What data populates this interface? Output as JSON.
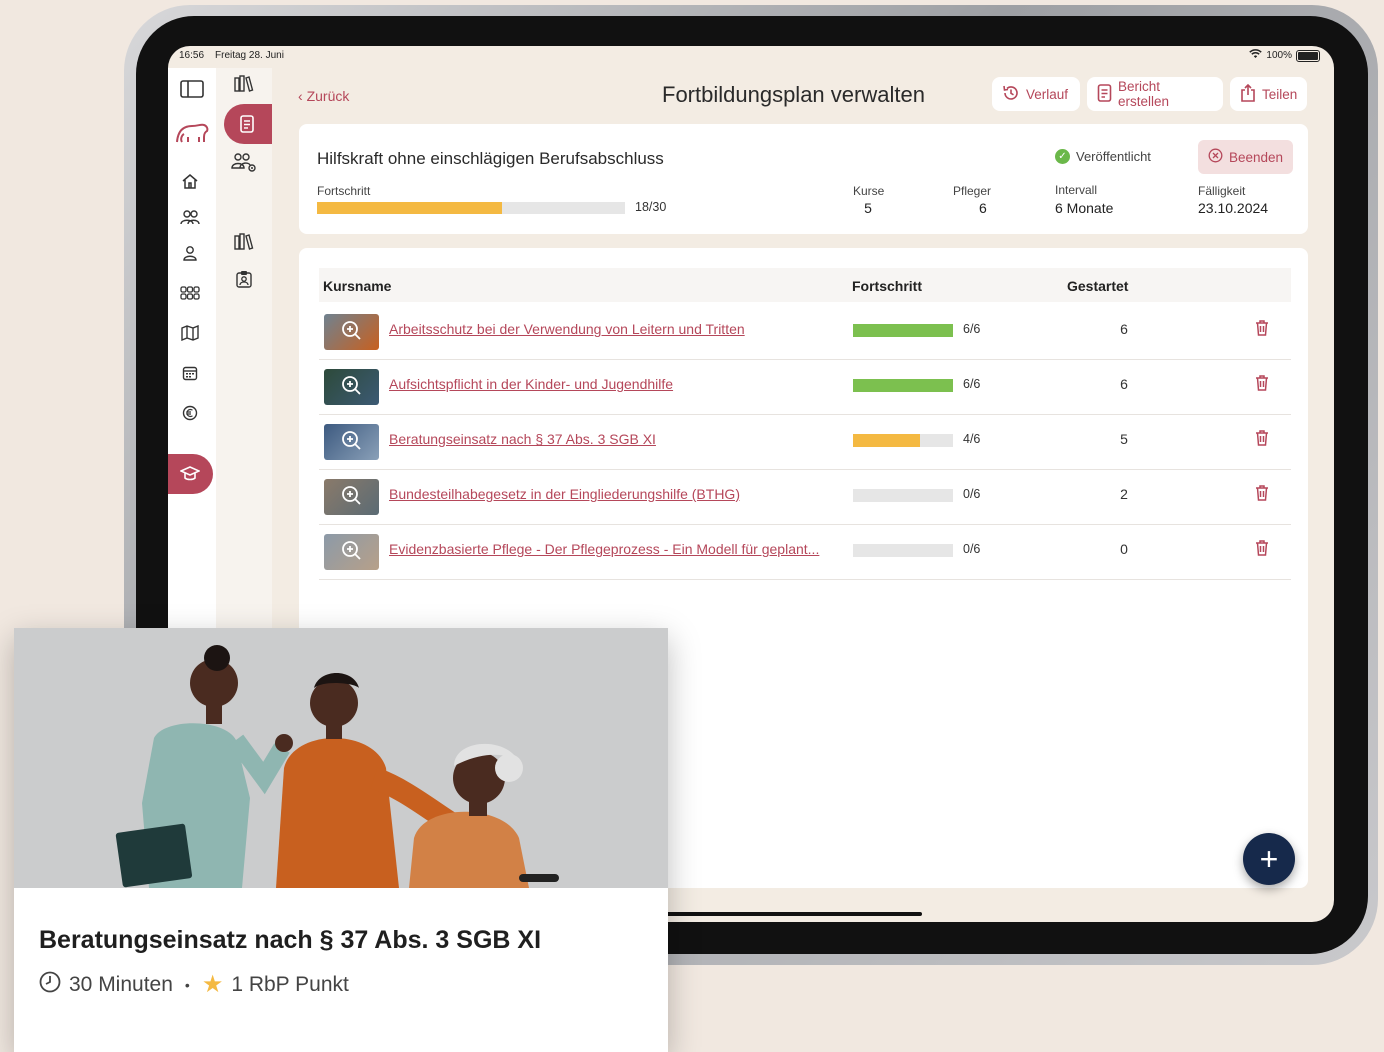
{
  "status_bar": {
    "time": "16:56",
    "date": "Freitag 28. Juni",
    "battery": "100%"
  },
  "header": {
    "back_label": "Zurück",
    "title": "Fortbildungsplan verwalten",
    "buttons": {
      "history": "Verlauf",
      "report": "Bericht erstellen",
      "share": "Teilen"
    }
  },
  "plan": {
    "name": "Hilfskraft ohne einschlägigen Berufsabschluss",
    "status": "Veröffentlicht",
    "end_label": "Beenden",
    "progress_label": "Fortschritt",
    "progress_text": "18/30",
    "progress_fraction": 0.6,
    "stats": {
      "courses_label": "Kurse",
      "courses": "5",
      "carers_label": "Pfleger",
      "carers": "6",
      "interval_label": "Intervall",
      "interval": "6 Monate",
      "due_label": "Fälligkeit",
      "due": "23.10.2024"
    }
  },
  "table": {
    "headers": {
      "name": "Kursname",
      "progress": "Fortschritt",
      "started": "Gestartet"
    },
    "rows": [
      {
        "name": "Arbeitsschutz bei der Verwendung von Leitern und Tritten",
        "progress_text": "6/6",
        "progress_fraction": 1.0,
        "started": "6",
        "color": "#7cc04f"
      },
      {
        "name": "Aufsichtspflicht in der Kinder- und Jugendhilfe",
        "progress_text": "6/6",
        "progress_fraction": 1.0,
        "started": "6",
        "color": "#7cc04f"
      },
      {
        "name": "Beratungseinsatz nach § 37 Abs. 3 SGB XI",
        "progress_text": "4/6",
        "progress_fraction": 0.667,
        "started": "5",
        "color": "#f4b942"
      },
      {
        "name": "Bundesteilhabegesetz in der Eingliederungshilfe (BTHG)",
        "progress_text": "0/6",
        "progress_fraction": 0,
        "started": "2",
        "color": "#f4b942"
      },
      {
        "name": "Evidenzbasierte Pflege - Der Pflegeprozess - Ein Modell für geplant...",
        "progress_text": "0/6",
        "progress_fraction": 0,
        "started": "0",
        "color": "#f4b942"
      }
    ]
  },
  "fab": {
    "label": "+"
  },
  "overlay_card": {
    "title": "Beratungseinsatz nach § 37 Abs. 3 SGB XI",
    "duration": "30 Minuten",
    "separator": "•",
    "points": "1 RbP Punkt"
  },
  "colors": {
    "accent": "#b5475a",
    "progress_orange": "#f4b942",
    "progress_green": "#7cc04f",
    "fab": "#16294b"
  }
}
